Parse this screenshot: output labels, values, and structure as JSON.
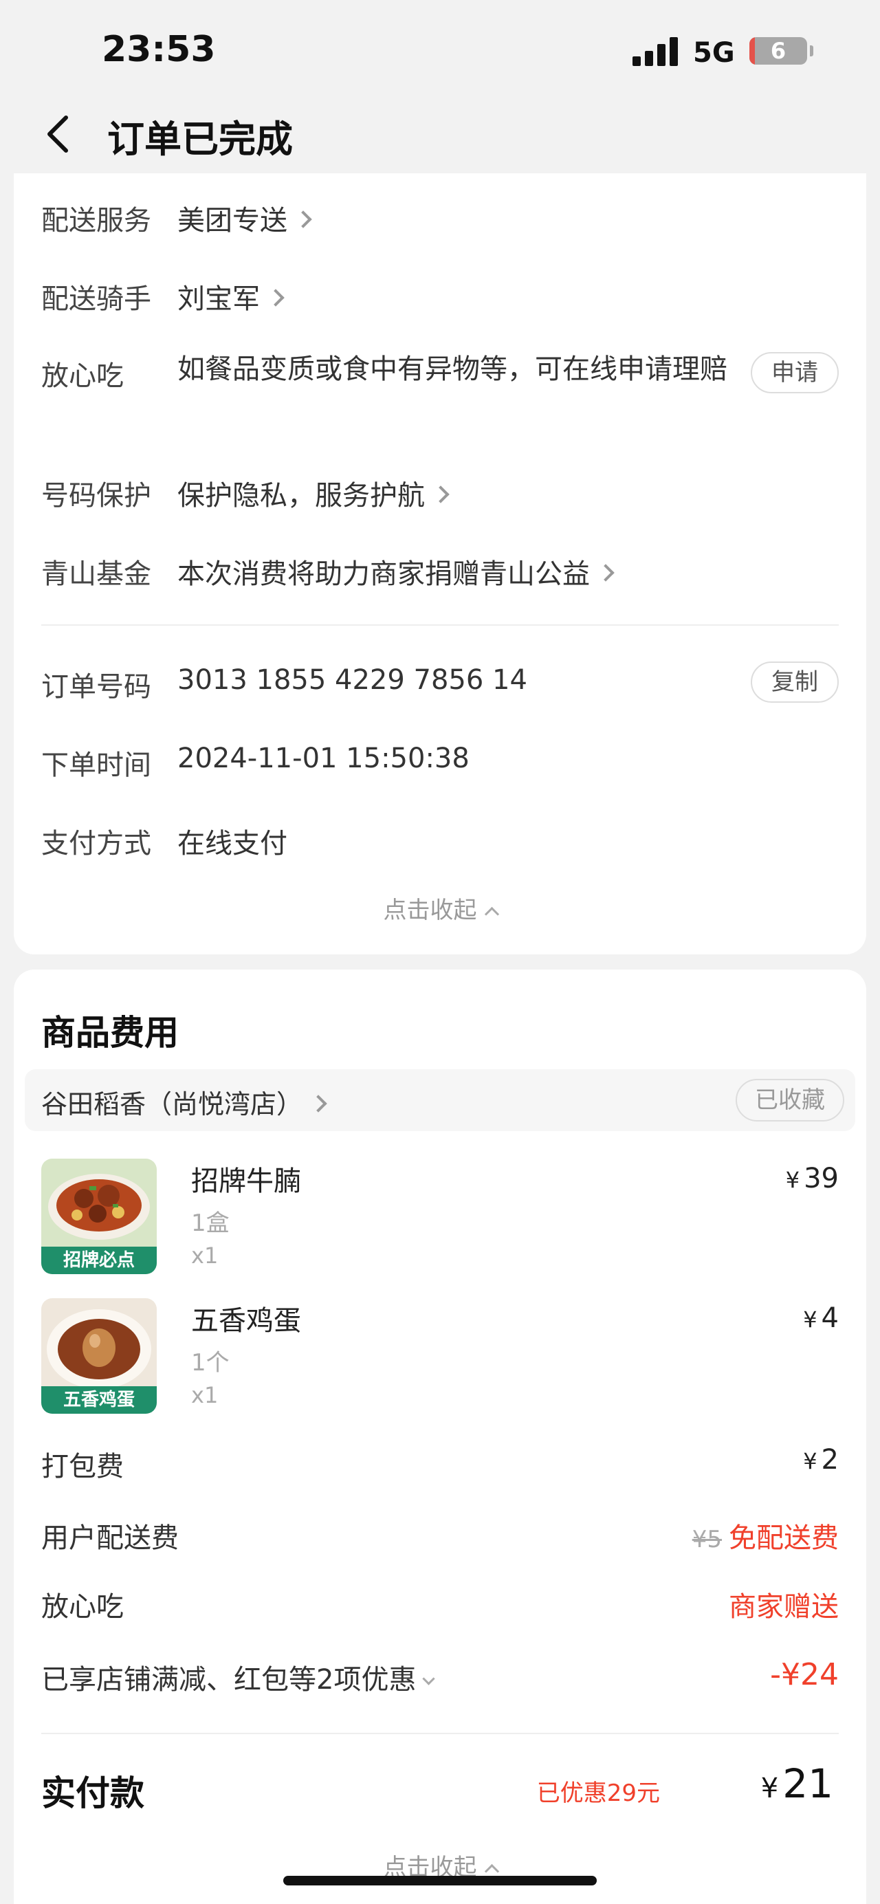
{
  "status_bar": {
    "time": "23:53",
    "network": "5G",
    "battery": "6"
  },
  "header": {
    "title": "订单已完成"
  },
  "delivery_info": [
    {
      "label": "配送服务",
      "value": "美团专送"
    },
    {
      "label": "配送骑手",
      "value": "刘宝军"
    },
    {
      "label": "放心吃",
      "value": "如餐品变质或食中有异物等，可在线申请理赔",
      "action": "申请"
    },
    {
      "label": "号码保护",
      "value": "保护隐私，服务护航"
    },
    {
      "label": "青山基金",
      "value": "本次消费将助力商家捐赠青山公益"
    }
  ],
  "order_info": [
    {
      "label": "订单号码",
      "value": "3013 1855 4229 7856 14",
      "action": "复制"
    },
    {
      "label": "下单时间",
      "value": "2024-11-01 15:50:38"
    },
    {
      "label": "支付方式",
      "value": "在线支付"
    }
  ],
  "collapse_label": "点击收起",
  "goods": {
    "title": "商品费用",
    "store_name": "谷田稻香（尚悦湾店）",
    "favorite_label": "已收藏",
    "items": [
      {
        "name": "招牌牛腩",
        "spec": "1盒",
        "qty": "x1",
        "price": "39",
        "tag": "招牌必点"
      },
      {
        "name": "五香鸡蛋",
        "spec": "1个",
        "qty": "x1",
        "price": "4",
        "tag": "五香鸡蛋"
      }
    ],
    "packing_fee": {
      "label": "打包费",
      "value": "2"
    },
    "delivery_fee": {
      "label": "用户配送费",
      "original": "¥5",
      "value": "免配送费"
    },
    "assurance": {
      "label": "放心吃",
      "value": "商家赠送"
    },
    "discounts": {
      "label": "已享店铺满减、红包等2项优惠",
      "value": "-¥24"
    },
    "total": {
      "label": "实付款",
      "saved": "已优惠29元",
      "value": "21"
    }
  },
  "currency": "¥",
  "colors": {
    "accent_red": "#f0402b",
    "background": "#f2f2f2",
    "card": "#ffffff"
  }
}
